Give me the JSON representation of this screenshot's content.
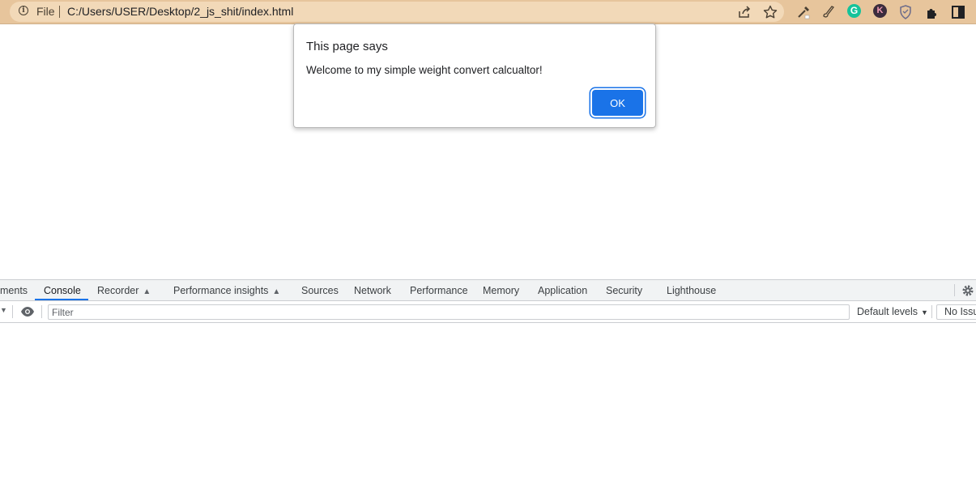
{
  "browser": {
    "scheme_label": "File",
    "url": "C:/Users/USER/Desktop/2_js_shit/index.html",
    "extensions": {
      "g_badge": "G",
      "k_badge": "K"
    }
  },
  "dialog": {
    "title": "This page says",
    "message": "Welcome to my simple weight convert calcualtor!",
    "ok_label": "OK"
  },
  "devtools": {
    "tabs": [
      {
        "label": "ments"
      },
      {
        "label": "Console"
      },
      {
        "label": "Recorder"
      },
      {
        "label": "Performance insights"
      },
      {
        "label": "Sources"
      },
      {
        "label": "Network"
      },
      {
        "label": "Performance"
      },
      {
        "label": "Memory"
      },
      {
        "label": "Application"
      },
      {
        "label": "Security"
      },
      {
        "label": "Lighthouse"
      }
    ],
    "active_tab": "Console",
    "filter_placeholder": "Filter",
    "levels_label": "Default levels",
    "issues_label": "No Issues"
  },
  "colors": {
    "accent": "#1a73e8",
    "topbar": "#e7c59c"
  }
}
